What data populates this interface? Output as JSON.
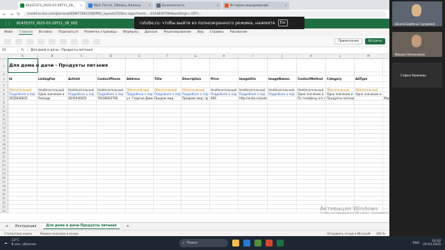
{
  "browser": {
    "tabs": [
      {
        "label": "81435373_2025-03-29T11_28_",
        "active": true
      },
      {
        "label": "Mail: Почта, Облако, Календ",
        "active": false
      },
      {
        "label": "Безопасность",
        "active": false
      },
      {
        "label": "История сканирований",
        "active": false
      }
    ],
    "url": "onedrive.live.com/personal/668f710b12580f90/_layouts/15/Doc.aspx?resid=...43248497669&wdOrigin=OFFI...",
    "toast_text": "rutube.ru: чтобы выйти из полноэкранного режима, нажмите",
    "toast_key": "Esc"
  },
  "excel": {
    "file_title": "81435373_2025-03-29T11_28_00Z",
    "search_placeholder": "Поиск инструментов, справки и других ресурсов",
    "menu": [
      "Файл",
      "Главная",
      "Вставка",
      "Поделиться",
      "Разметка страницы",
      "Формулы",
      "Данные",
      "Рецензирование",
      "Вид",
      "Справка",
      "Рисование"
    ],
    "menu_active": "Главная",
    "comments": "Примечания",
    "share": "Встреча",
    "cell_ref": "A1",
    "fx": "fx",
    "formula": "Для дома и дачи - Продукты питания",
    "columns": [
      "A",
      "B",
      "C",
      "D",
      "E",
      "F",
      "G",
      "H",
      "I",
      "J",
      "K",
      "L",
      "M"
    ],
    "rows": [
      "1",
      "2",
      "3",
      "4",
      "5",
      "6",
      "7",
      "8",
      "9",
      "10",
      "11",
      "12",
      "13",
      "14",
      "15",
      "16",
      "17",
      "18",
      "19",
      "20",
      "21",
      "22",
      "23",
      "24",
      "25",
      "26",
      "27",
      "28",
      "29",
      "30",
      "31",
      "32",
      "33",
      "34"
    ],
    "title_cell": "Для дома и дачи - Продукты питания",
    "headers": [
      "Id",
      "ListingFee",
      "AvitoId",
      "ContactPhone",
      "Address",
      "Title",
      "Description",
      "Price",
      "ImageUrls",
      "ImageNames",
      "ContactMethod",
      "Category",
      "AdType"
    ],
    "required_row": [
      "Обязательный",
      "Необязательный",
      "Необязательный",
      "Необязательный",
      "Обязательный",
      "Обязательный",
      "Обязательный",
      "Необязательный",
      "Необязательный",
      "Необязательный",
      "Необязательный",
      "Обязательный",
      "Обязательный"
    ],
    "hint_row": [
      "Подробнее о пар",
      "Одно значение и",
      "Подробнее о пар",
      "Подробнее о пар",
      "Подробнее о пар",
      "Подробнее о пар",
      "Подробнее о пар",
      "Подробнее о пар",
      "Подробнее о пар",
      "Подробнее о пар",
      "Одно значение и",
      "Одно значение и",
      "Одно значение и"
    ],
    "data_row": [
      "2635640625",
      "Package",
      "2635640625",
      "79198003706",
      "ул. Георгия Димит",
      "Продаю мед",
      "Продаем мед, пр",
      "600",
      "http://avito.ru/autoload/1/items-to-fe",
      "",
      "По телефону и в с",
      "Продукты питания",
      ""
    ],
    "data_row_extra": "Марина",
    "sheets": [
      "Инструкция",
      "Для дома и дачи-Продукты питания"
    ],
    "active_sheet": "Для дома и дачи-Продукты питания",
    "status_left": "Статистика книги",
    "status_mode": "Режим пользова в конце",
    "status_feedback": "Отправить отзыв в Microsoft",
    "zoom": "100 %"
  },
  "watermark": {
    "title": "Активация Windows",
    "subtitle": "Чтобы активировать Windows, перейдите в раздел \"Параметры\"."
  },
  "taskbar": {
    "weather_temp": "13°C",
    "weather_desc": "В осн. облачно",
    "search": "Поиск",
    "lang": "ENG",
    "time": "14:42",
    "date": "29.03.2025"
  },
  "participants": [
    {
      "name": "Школа Барбены Груздевой"
    },
    {
      "name": "Михаил Овчинников"
    },
    {
      "name": "Софья Крамова"
    }
  ]
}
